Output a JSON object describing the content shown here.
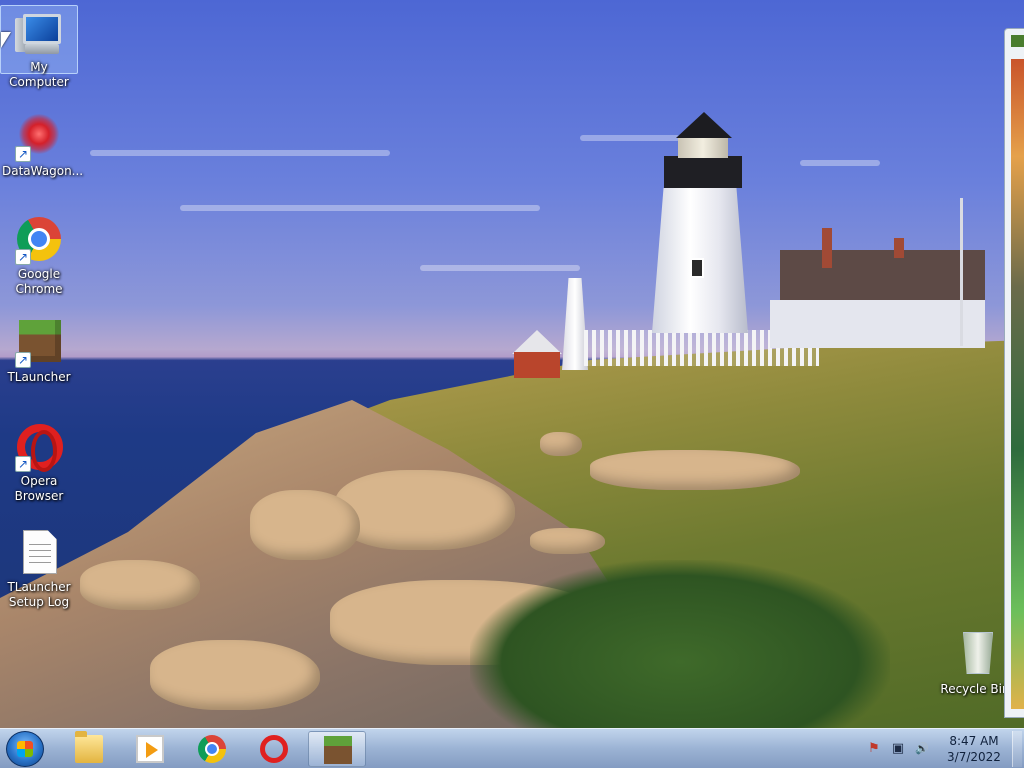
{
  "desktop": {
    "icons": [
      {
        "id": "my-computer",
        "label": "My Computer",
        "icon": "computer-icon",
        "shortcut": false,
        "selected": true
      },
      {
        "id": "datawagon",
        "label": "DataWagon...",
        "icon": "datawagon-icon",
        "shortcut": true,
        "selected": false
      },
      {
        "id": "google-chrome",
        "label": "Google Chrome",
        "icon": "chrome-icon",
        "shortcut": true,
        "selected": false
      },
      {
        "id": "tlauncher",
        "label": "TLauncher",
        "icon": "minecraft-grass-block-icon",
        "shortcut": true,
        "selected": false
      },
      {
        "id": "opera-browser",
        "label": "Opera Browser",
        "icon": "opera-icon",
        "shortcut": true,
        "selected": false
      },
      {
        "id": "tlauncher-setup-log",
        "label": "TLauncher Setup Log",
        "icon": "text-document-icon",
        "shortcut": false,
        "selected": false
      },
      {
        "id": "recycle-bin",
        "label": "Recycle Bin",
        "icon": "recycle-bin-icon",
        "shortcut": false,
        "selected": false
      }
    ],
    "shortcut_glyph": "↗"
  },
  "taskbar": {
    "start_button": {
      "icon": "windows-start-orb-icon"
    },
    "pinned": [
      {
        "id": "explorer",
        "icon": "folder-icon",
        "active": false
      },
      {
        "id": "media-player",
        "icon": "media-player-icon",
        "active": false
      },
      {
        "id": "chrome",
        "icon": "chrome-icon",
        "active": false
      },
      {
        "id": "opera",
        "icon": "opera-icon",
        "active": false
      },
      {
        "id": "tlauncher",
        "icon": "minecraft-grass-block-icon",
        "active": true
      }
    ],
    "tray": {
      "icons": [
        "action-center-flag-icon",
        "network-icon",
        "volume-icon"
      ],
      "glyphs": {
        "flag": "⚑",
        "network": "▣",
        "volume": "🔊"
      }
    },
    "clock": {
      "time": "8:47 AM",
      "date": "3/7/2022"
    }
  },
  "colors": {
    "taskbar": "#9fb5d6",
    "chrome_red": "#db4437",
    "opera_red": "#e0201f"
  }
}
